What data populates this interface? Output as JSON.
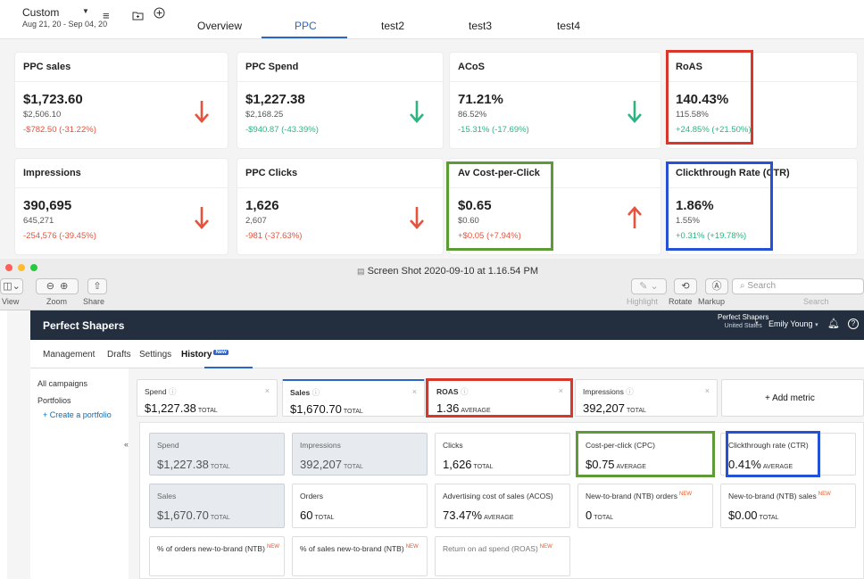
{
  "dashboard": {
    "date_label": "Custom",
    "date_range": "Aug 21, 20 - Sep 04, 20",
    "tabs": [
      "Overview",
      "PPC",
      "test2",
      "test3",
      "test4"
    ],
    "active_tab": "PPC",
    "cards": [
      {
        "title": "PPC sales",
        "value": "$1,723.60",
        "previous": "$2,506.10",
        "change": "-$782.50 (-31.22%)",
        "trend": "down",
        "highlight": ""
      },
      {
        "title": "PPC Spend",
        "value": "$1,227.38",
        "previous": "$2,168.25",
        "change": "-$940.87 (-43.39%)",
        "trend": "down-good",
        "highlight": ""
      },
      {
        "title": "ACoS",
        "value": "71.21%",
        "previous": "86.52%",
        "change": "-15.31% (-17.69%)",
        "trend": "down-good",
        "highlight": ""
      },
      {
        "title": "RoAS",
        "value": "140.43%",
        "previous": "115.58%",
        "change": "+24.85% (+21.50%)",
        "trend": "up-good",
        "highlight": "#d8372a"
      },
      {
        "title": "Impressions",
        "value": "390,695",
        "previous": "645,271",
        "change": "-254,576 (-39.45%)",
        "trend": "down",
        "highlight": ""
      },
      {
        "title": "PPC Clicks",
        "value": "1,626",
        "previous": "2,607",
        "change": "-981 (-37.63%)",
        "trend": "down",
        "highlight": ""
      },
      {
        "title": "Av Cost-per-Click",
        "value": "$0.65",
        "previous": "$0.60",
        "change": "+$0.05 (+7.94%)",
        "trend": "up-bad",
        "highlight": "#5e9b36"
      },
      {
        "title": "Clickthrough Rate (CTR)",
        "value": "1.86%",
        "previous": "1.55%",
        "change": "+0.31% (+19.78%)",
        "trend": "up-good",
        "highlight": "#2451d6"
      }
    ]
  },
  "window": {
    "title": "Screen Shot 2020-09-10 at 1.16.54 PM",
    "toolbar_left": [
      "View",
      "Zoom",
      "Share"
    ],
    "toolbar_right": [
      "Highlight",
      "Rotate",
      "Markup",
      "Search"
    ],
    "search_placeholder": "Search"
  },
  "app": {
    "brand": "Perfect Shapers",
    "account": "Perfect Shapers",
    "account_region": "United States",
    "user": "Emily Young",
    "nav": [
      "Management",
      "Drafts",
      "Settings",
      "History"
    ],
    "nav_new": "New",
    "sidebar": [
      "All campaigns",
      "Portfolios",
      "+ Create a portfolio"
    ],
    "metric_cards": [
      {
        "title": "Spend",
        "value": "$1,227.38",
        "unit": "TOTAL"
      },
      {
        "title": "Sales",
        "value": "$1,670.70",
        "unit": "TOTAL"
      },
      {
        "title": "ROAS",
        "value": "1.36",
        "unit": "AVERAGE"
      },
      {
        "title": "Impressions",
        "value": "392,207",
        "unit": "TOTAL"
      }
    ],
    "add_metric": "+ Add metric",
    "tiles_row1": [
      {
        "title": "Spend",
        "value": "$1,227.38",
        "unit": "TOTAL"
      },
      {
        "title": "Impressions",
        "value": "392,207",
        "unit": "TOTAL"
      },
      {
        "title": "Clicks",
        "value": "1,626",
        "unit": "TOTAL"
      },
      {
        "title": "Cost-per-click (CPC)",
        "value": "$0.75",
        "unit": "AVERAGE"
      },
      {
        "title": "Clickthrough rate (CTR)",
        "value": "0.41%",
        "unit": "AVERAGE"
      }
    ],
    "tiles_row2": [
      {
        "title": "Sales",
        "value": "$1,670.70",
        "unit": "TOTAL"
      },
      {
        "title": "Orders",
        "value": "60",
        "unit": "TOTAL"
      },
      {
        "title": "Advertising cost of sales (ACOS)",
        "value": "73.47%",
        "unit": "AVERAGE"
      },
      {
        "title": "New-to-brand (NTB) orders",
        "value": "0",
        "unit": "TOTAL",
        "tag": "NEW"
      },
      {
        "title": "New-to-brand (NTB) sales",
        "value": "$0.00",
        "unit": "TOTAL",
        "tag": "NEW"
      }
    ],
    "tiles_row3": [
      {
        "title": "% of orders new-to-brand (NTB)",
        "tag": "NEW"
      },
      {
        "title": "% of sales new-to-brand (NTB)",
        "tag": "NEW"
      },
      {
        "title": "Return on ad spend (ROAS)",
        "tag": "NEW"
      }
    ]
  }
}
